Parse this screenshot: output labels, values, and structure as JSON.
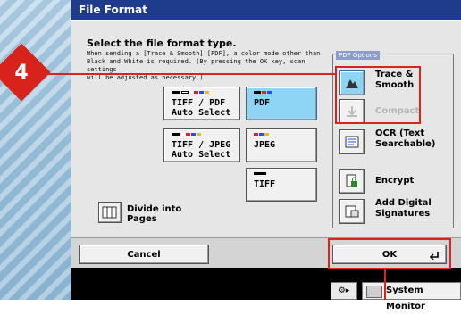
{
  "window": {
    "title": "File Format"
  },
  "main": {
    "heading": "Select the file format type.",
    "description": "When sending a [Trace & Smooth] [PDF], a color mode other than\nBlack and White is required. (By pressing the OK key, scan settings\nwill be adjusted as necessary.)"
  },
  "formats": {
    "tiff_pdf_auto": "TIFF / PDF\nAuto Select",
    "pdf": "PDF",
    "tiff_jpeg_auto": "TIFF / JPEG\nAuto Select",
    "jpeg": "JPEG",
    "tiff": "TIFF",
    "selected": "PDF"
  },
  "divide": {
    "label": "Divide into\nPages"
  },
  "pdf_options": {
    "title": "PDF Options",
    "trace_smooth": "Trace &\nSmooth",
    "compact": "Compact",
    "ocr": "OCR (Text\nSearchable)",
    "encrypt": "Encrypt",
    "digital_signatures": "Add Digital\nSignatures"
  },
  "footer": {
    "cancel_label": "Cancel",
    "ok_label": "OK"
  },
  "taskbar": {
    "system_monitor_label": "System Monitor"
  },
  "callout": {
    "step_number": "4"
  },
  "colors": {
    "title_bar": "#1f3b8c",
    "selected": "#8ed4f4",
    "callout": "#e0201a"
  }
}
